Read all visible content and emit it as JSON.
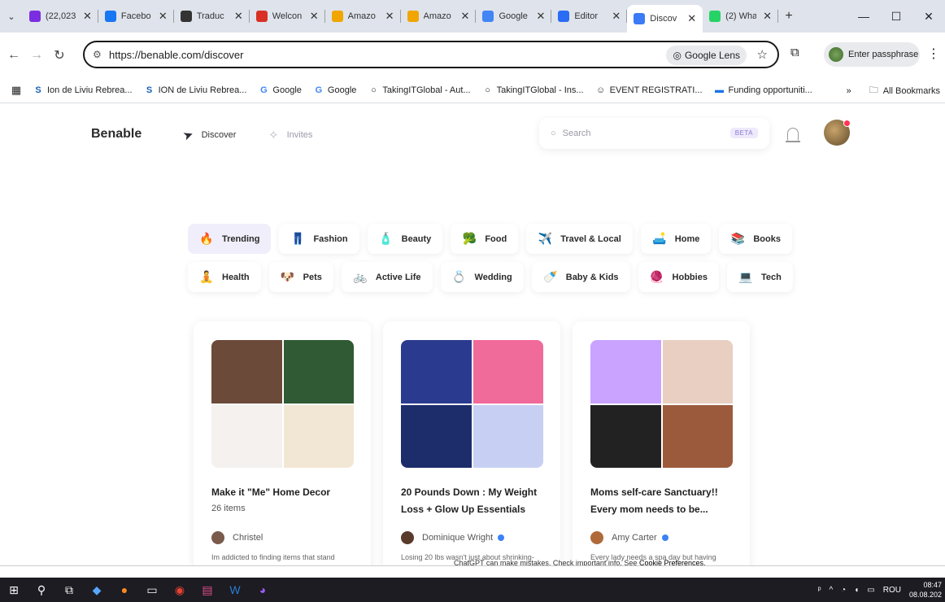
{
  "browser": {
    "tabs": [
      {
        "label": "(22,023",
        "icon": "mail-icon",
        "color": "#7b2ee0"
      },
      {
        "label": "Facebo",
        "icon": "facebook-icon",
        "color": "#1877f2"
      },
      {
        "label": "Traduc",
        "icon": "openai-icon",
        "color": "#333333"
      },
      {
        "label": "Welcon",
        "icon": "gmail-icon",
        "color": "#d93025"
      },
      {
        "label": "Amazo",
        "icon": "amazon-icon",
        "color": "#f0a500"
      },
      {
        "label": "Amazo",
        "icon": "amazon-icon",
        "color": "#f0a500"
      },
      {
        "label": "Google",
        "icon": "google-translate-icon",
        "color": "#4285f4"
      },
      {
        "label": "Editor",
        "icon": "editor-icon",
        "color": "#2a6df4"
      },
      {
        "label": "Discov",
        "icon": "benable-icon",
        "color": "#3b7bf5",
        "active": true
      },
      {
        "label": "(2) Wha",
        "icon": "whatsapp-icon",
        "color": "#25d366"
      }
    ],
    "url": "https://benable.com/discover",
    "lens_label": "Google Lens",
    "profile_label": "Enter passphrase",
    "bookmarks": [
      {
        "label": "Ion de Liviu Rebrea...",
        "icon": "ion-icon"
      },
      {
        "label": "ION de Liviu Rebrea...",
        "icon": "ion-icon"
      },
      {
        "label": "Google",
        "icon": "google-icon"
      },
      {
        "label": "Google",
        "icon": "google-icon"
      },
      {
        "label": "TakingITGlobal - Aut...",
        "icon": "tig-icon"
      },
      {
        "label": "TakingITGlobal - Ins...",
        "icon": "tig-icon"
      },
      {
        "label": "EVENT REGISTRATI...",
        "icon": "event-icon"
      },
      {
        "label": "Funding opportuniti...",
        "icon": "funding-icon"
      }
    ],
    "bookmarks_overflow": "»",
    "all_bookmarks": "All Bookmarks"
  },
  "header": {
    "logo": "Benable",
    "nav": {
      "discover": "Discover",
      "invites": "Invites"
    },
    "search_placeholder": "Search",
    "beta": "BETA"
  },
  "categories": [
    [
      {
        "label": "Trending",
        "icon": "🔥",
        "selected": true
      },
      {
        "label": "Fashion",
        "icon": "👖"
      },
      {
        "label": "Beauty",
        "icon": "🧴"
      },
      {
        "label": "Food",
        "icon": "🥦"
      },
      {
        "label": "Travel & Local",
        "icon": "✈️"
      },
      {
        "label": "Home",
        "icon": "🛋️"
      },
      {
        "label": "Books",
        "icon": "📚"
      }
    ],
    [
      {
        "label": "Health",
        "icon": "🧘"
      },
      {
        "label": "Pets",
        "icon": "🐶"
      },
      {
        "label": "Active Life",
        "icon": "🚲"
      },
      {
        "label": "Wedding",
        "icon": "💍"
      },
      {
        "label": "Baby & Kids",
        "icon": "🍼"
      },
      {
        "label": "Hobbies",
        "icon": "🧶"
      },
      {
        "label": "Tech",
        "icon": "💻"
      }
    ]
  ],
  "cards": [
    {
      "title": "Make it \"Me\" Home Decor",
      "count": "26 items",
      "author": "Christel",
      "verified": false,
      "desc": "Im addicted to finding items that stand",
      "palette": [
        "#6b4a3a",
        "#2f5a33",
        "#f4f1ee",
        "#f2e7d4"
      ]
    },
    {
      "title": "20 Pounds Down : My Weight Loss + Glow Up Essentials",
      "count": "",
      "author": "Dominique Wright",
      "verified": true,
      "desc": "Losing 20 lbs wasn't just about shrinking-",
      "palette": [
        "#2a3b8f",
        "#f06a9a",
        "#1d2c6b",
        "#c7d0f2"
      ]
    },
    {
      "title": "Moms self-care Sanctuary!! Every mom needs to be...",
      "count": "",
      "author": "Amy Carter",
      "verified": true,
      "desc": "Every lady needs a spa day but having",
      "palette": [
        "#c9a3ff",
        "#e8cfc1",
        "#222222",
        "#9c5a3c"
      ]
    }
  ],
  "banner": {
    "text": "ChatGPT can make mistakes. Check important info. See",
    "link": "Cookie Preferences."
  },
  "taskbar": {
    "language": "ROU",
    "time": "08:47",
    "date": "08.08.202"
  }
}
